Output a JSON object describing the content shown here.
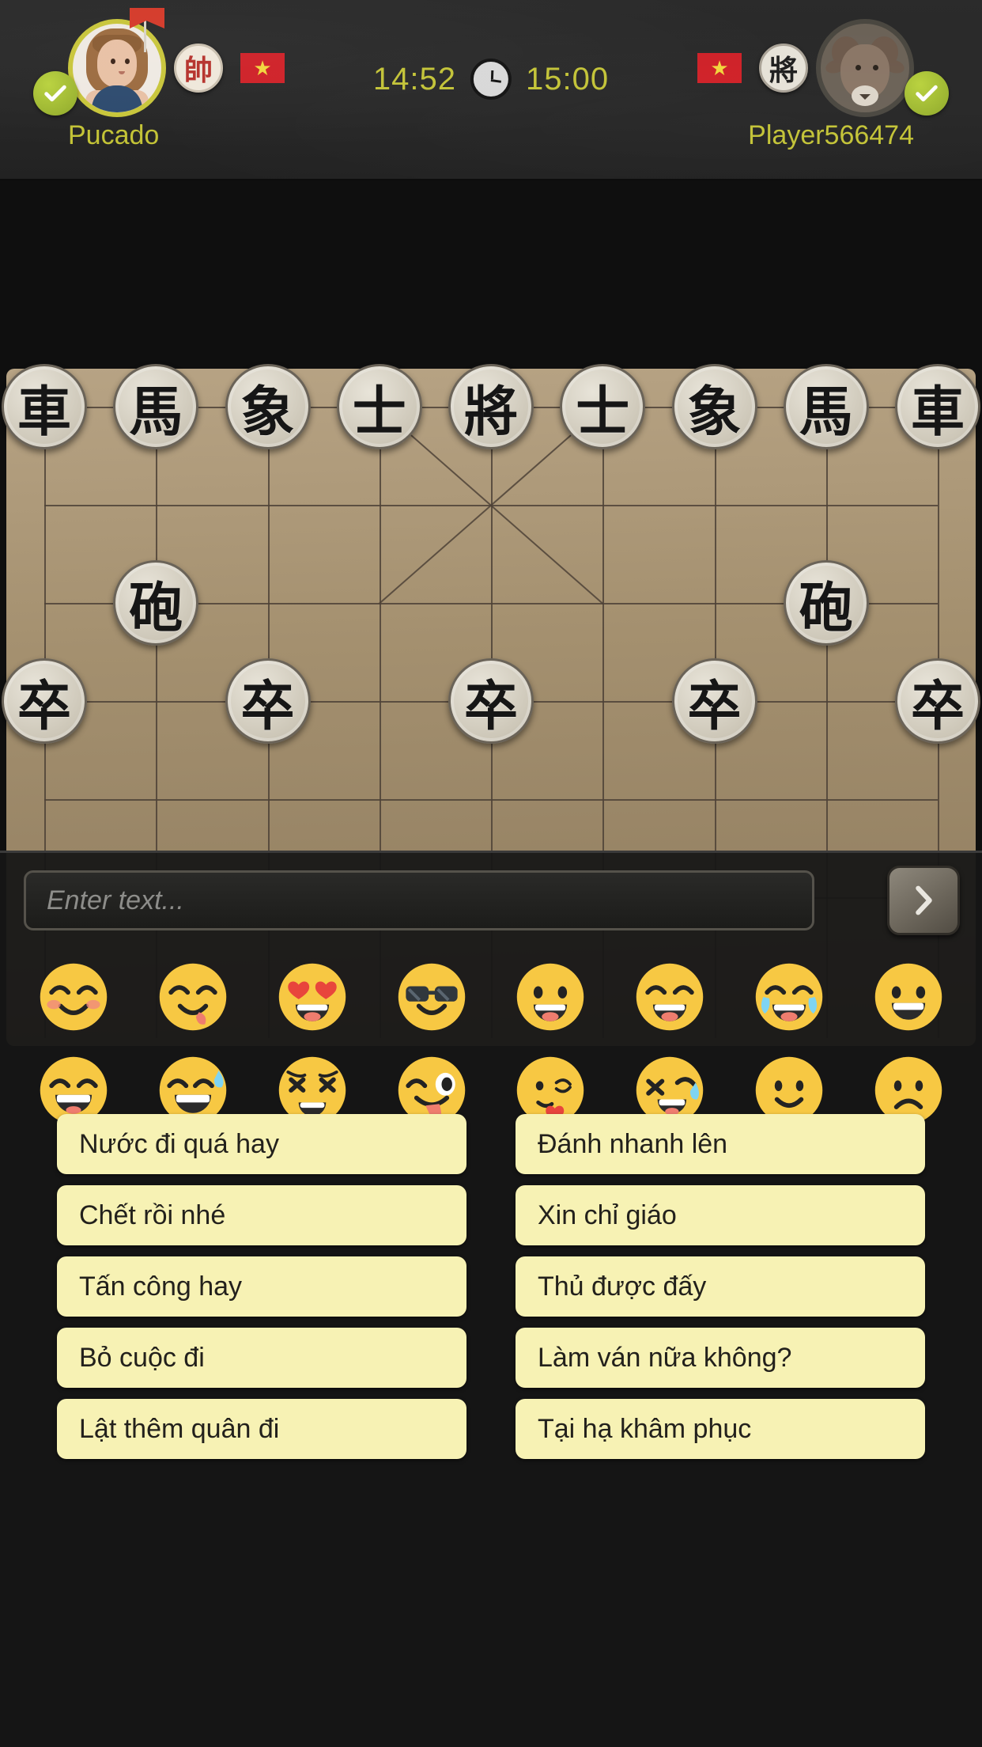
{
  "header": {
    "left_player": {
      "name": "Pucado",
      "avatar_icon": "girl-avatar",
      "piece_char": "帥",
      "piece_color": "#b5302a",
      "flag_pin_icon": "red-flag-pin-icon",
      "country_flag_icon": "vietnam-flag-icon",
      "flag_star": "★",
      "ready_icon": "check-badge-icon",
      "ring_color": "#c8c53a"
    },
    "right_player": {
      "name": "Player566474",
      "avatar_icon": "ram-avatar",
      "piece_char": "將",
      "piece_color": "#1e1e1e",
      "country_flag_icon": "vietnam-flag-icon",
      "flag_star": "★",
      "ready_icon": "check-badge-icon",
      "ring_color": "#4a4740"
    },
    "clock": {
      "left_time": "14:52",
      "right_time": "15:00",
      "clock_icon": "analog-clock-icon",
      "text_color": "#c3c336"
    }
  },
  "board": {
    "background_color": "#a4906f",
    "line_color": "#4e4237",
    "cols": 9,
    "rows": 10,
    "pieces": [
      {
        "char": "車",
        "col": 0,
        "row": 0,
        "name": "chariot"
      },
      {
        "char": "馬",
        "col": 1,
        "row": 0,
        "name": "horse"
      },
      {
        "char": "象",
        "col": 2,
        "row": 0,
        "name": "elephant"
      },
      {
        "char": "士",
        "col": 3,
        "row": 0,
        "name": "advisor"
      },
      {
        "char": "將",
        "col": 4,
        "row": 0,
        "name": "general"
      },
      {
        "char": "士",
        "col": 5,
        "row": 0,
        "name": "advisor"
      },
      {
        "char": "象",
        "col": 6,
        "row": 0,
        "name": "elephant"
      },
      {
        "char": "馬",
        "col": 7,
        "row": 0,
        "name": "horse"
      },
      {
        "char": "車",
        "col": 8,
        "row": 0,
        "name": "chariot"
      },
      {
        "char": "砲",
        "col": 1,
        "row": 2,
        "name": "cannon"
      },
      {
        "char": "砲",
        "col": 7,
        "row": 2,
        "name": "cannon"
      },
      {
        "char": "卒",
        "col": 0,
        "row": 3,
        "name": "soldier"
      },
      {
        "char": "卒",
        "col": 2,
        "row": 3,
        "name": "soldier"
      },
      {
        "char": "卒",
        "col": 4,
        "row": 3,
        "name": "soldier"
      },
      {
        "char": "卒",
        "col": 6,
        "row": 3,
        "name": "soldier"
      },
      {
        "char": "卒",
        "col": 8,
        "row": 3,
        "name": "soldier"
      }
    ]
  },
  "chat": {
    "input_placeholder": "Enter text...",
    "input_value": "",
    "send_icon": "chevron-right-icon",
    "emojis": [
      {
        "name": "smiling-face-with-blush-emoji",
        "kind": "blush"
      },
      {
        "name": "face-savoring-food-emoji",
        "kind": "yum"
      },
      {
        "name": "smiling-face-with-heart-eyes-emoji",
        "kind": "hearteyes"
      },
      {
        "name": "smiling-face-with-sunglasses-emoji",
        "kind": "sunglasses"
      },
      {
        "name": "grinning-face-with-big-eyes-emoji",
        "kind": "bigeyes"
      },
      {
        "name": "grinning-squinting-face-emoji",
        "kind": "laugh"
      },
      {
        "name": "face-with-tears-of-joy-emoji",
        "kind": "joy"
      },
      {
        "name": "grinning-face-emoji",
        "kind": "grin"
      },
      {
        "name": "beaming-face-emoji",
        "kind": "beaming"
      },
      {
        "name": "grinning-face-with-sweat-emoji",
        "kind": "sweat"
      },
      {
        "name": "tired-distressed-face-emoji",
        "kind": "distressed"
      },
      {
        "name": "winking-face-with-tongue-emoji",
        "kind": "winktongue"
      },
      {
        "name": "face-blowing-a-kiss-emoji",
        "kind": "kiss"
      },
      {
        "name": "rolling-on-the-floor-laughing-emoji",
        "kind": "rofl"
      },
      {
        "name": "slightly-smiling-face-emoji",
        "kind": "slightsmile"
      },
      {
        "name": "slightly-frowning-face-emoji",
        "kind": "frown"
      }
    ],
    "quick_messages": [
      "Nước đi quá hay",
      "Đánh nhanh lên",
      "Chết rồi nhé",
      "Xin chỉ giáo",
      "Tấn công hay",
      "Thủ được đấy",
      "Bỏ cuộc đi",
      "Làm ván nữa không?",
      "Lật thêm quân đi",
      "Tại hạ khâm phục"
    ]
  }
}
